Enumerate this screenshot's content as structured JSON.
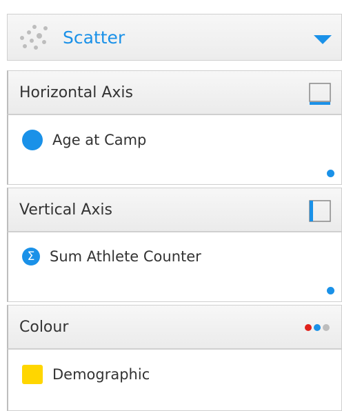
{
  "chart_type": {
    "label": "Scatter",
    "icon": "scatter-icon",
    "accent": "#1a91e8"
  },
  "sections": [
    {
      "title": "Horizontal Axis",
      "icon": "horizontal-axis-icon",
      "field": {
        "label": "Age at Camp",
        "icon": "dimension-dot-icon"
      }
    },
    {
      "title": "Vertical Axis",
      "icon": "vertical-axis-icon",
      "field": {
        "label": "Sum Athlete Counter",
        "icon": "sigma-icon"
      }
    },
    {
      "title": "Colour",
      "icon": "colour-dots-icon",
      "field": {
        "label": "Demographic",
        "icon": "colour-swatch-icon"
      }
    }
  ],
  "colors": {
    "blue": "#1a91e8",
    "red": "#e0221c",
    "yellow": "#ffd600",
    "gray": "#bdbdbd"
  }
}
